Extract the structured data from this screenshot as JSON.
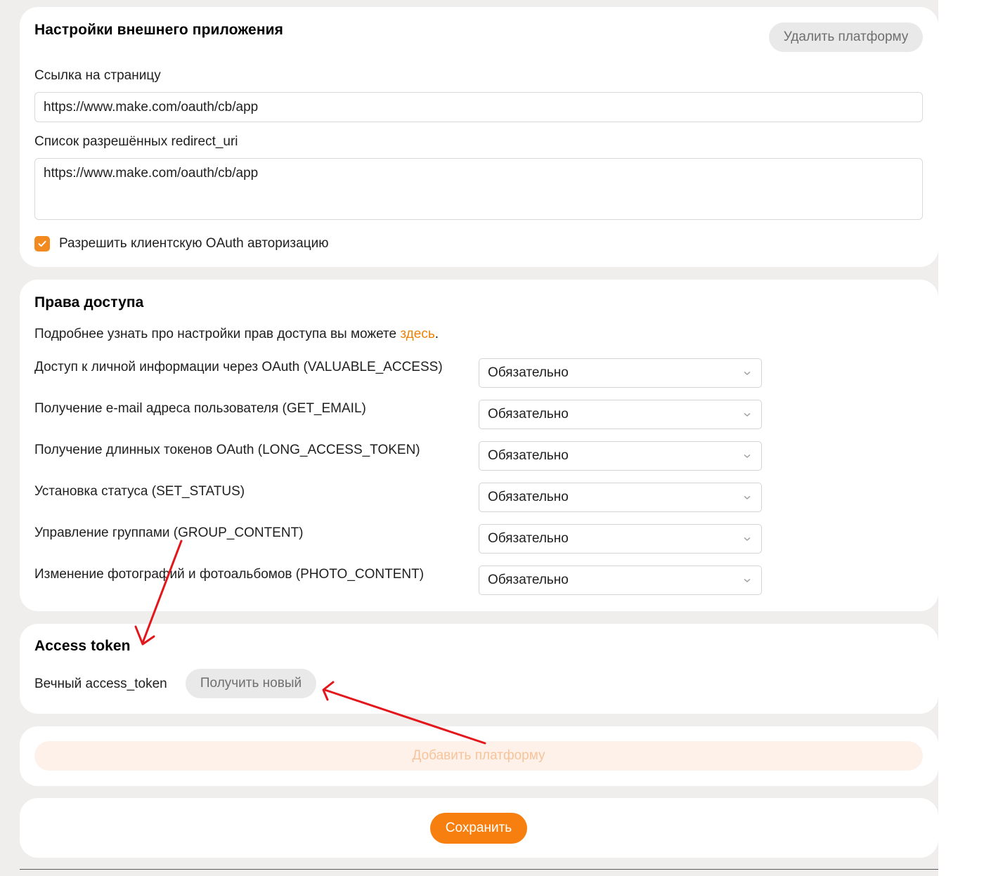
{
  "external_app": {
    "title": "Настройки внешнего приложения",
    "delete_button": "Удалить платформу",
    "page_link_label": "Ссылка на страницу",
    "page_link_value": "https://www.make.com/oauth/cb/app",
    "redirect_label": "Список разрешённых redirect_uri",
    "redirect_value": "https://www.make.com/oauth/cb/app",
    "client_oauth_label": "Разрешить клиентскую OAuth авторизацию",
    "client_oauth_checked": true
  },
  "access_rights": {
    "title": "Права доступа",
    "intro_text": "Подробнее узнать про настройки прав доступа вы можете ",
    "intro_link": "здесь",
    "intro_end": ".",
    "permissions": [
      {
        "label": "Доступ к личной информации через OAuth (VALUABLE_ACCESS)",
        "value": "Обязательно"
      },
      {
        "label": "Получение e-mail адреса пользователя (GET_EMAIL)",
        "value": "Обязательно"
      },
      {
        "label": "Получение длинных токенов OAuth (LONG_ACCESS_TOKEN)",
        "value": "Обязательно"
      },
      {
        "label": "Установка статуса (SET_STATUS)",
        "value": "Обязательно"
      },
      {
        "label": "Управление группами (GROUP_CONTENT)",
        "value": "Обязательно"
      },
      {
        "label": "Изменение фотографий и фотоальбомов (PHOTO_CONTENT)",
        "value": "Обязательно"
      }
    ]
  },
  "access_token": {
    "title": "Access token",
    "eternal_label": "Вечный access_token",
    "get_new_button": "Получить новый"
  },
  "add_platform": {
    "label": "Добавить платформу"
  },
  "save": {
    "label": "Сохранить"
  },
  "colors": {
    "accent": "#f77f0f",
    "link": "#ee8208",
    "checkbox": "#f28a1f",
    "annotation_arrow": "#e3161b",
    "page_background": "#f0eeec"
  },
  "icons": {
    "checkbox": "checkmark-icon",
    "select": "chevron-down-icon",
    "annotation": "red-arrow"
  }
}
